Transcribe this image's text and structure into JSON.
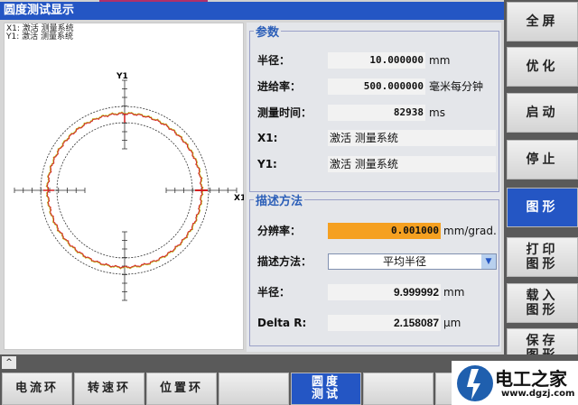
{
  "window": {
    "title": "圆度测试显示"
  },
  "plot": {
    "legend": [
      "X1: 激活 测量系统",
      "Y1: 激活 测量系统"
    ],
    "x_axis_label": "X1",
    "y_axis_label": "Y1",
    "colors": {
      "trace": "#d42020",
      "trace_alt": "#b8c020",
      "tolerance": "#333333"
    }
  },
  "params": {
    "title": "参数",
    "radius": {
      "label": "半径：",
      "value": "10.000000",
      "unit": "mm"
    },
    "feed": {
      "label": "进给率：",
      "value": "500.000000",
      "unit": "毫米每分钟"
    },
    "time": {
      "label": "测量时间：",
      "value": "82938",
      "unit": "ms"
    },
    "x1": {
      "label": "X1:",
      "value": "激活 测量系统"
    },
    "y1": {
      "label": "Y1:",
      "value": "激活 测量系统"
    }
  },
  "display": {
    "title": "描述方法",
    "resolution": {
      "label": "分辨率：",
      "value": "0.001000",
      "unit": "mm/grad."
    },
    "method": {
      "label": "描述方法：",
      "value": "平均半径"
    },
    "radius": {
      "label": "半径：",
      "value": "9.999992",
      "unit": "mm"
    },
    "delta": {
      "label": "Delta R:",
      "value": "2.158087",
      "unit": "µm"
    }
  },
  "softkeys_right": [
    "全屏",
    "优化",
    "启动",
    "停止",
    "图形",
    "打印\n图形",
    "载入\n图形",
    "保存\n图形"
  ],
  "softkeys_bottom": [
    "电流环",
    "转速环",
    "位置环",
    "",
    "圆度\n测试",
    "",
    ""
  ],
  "up_button": "^",
  "watermark": {
    "name": "电工之家",
    "url": "www.dgzj.com"
  },
  "accent": "#2456c4",
  "highlight": "#f5a020"
}
